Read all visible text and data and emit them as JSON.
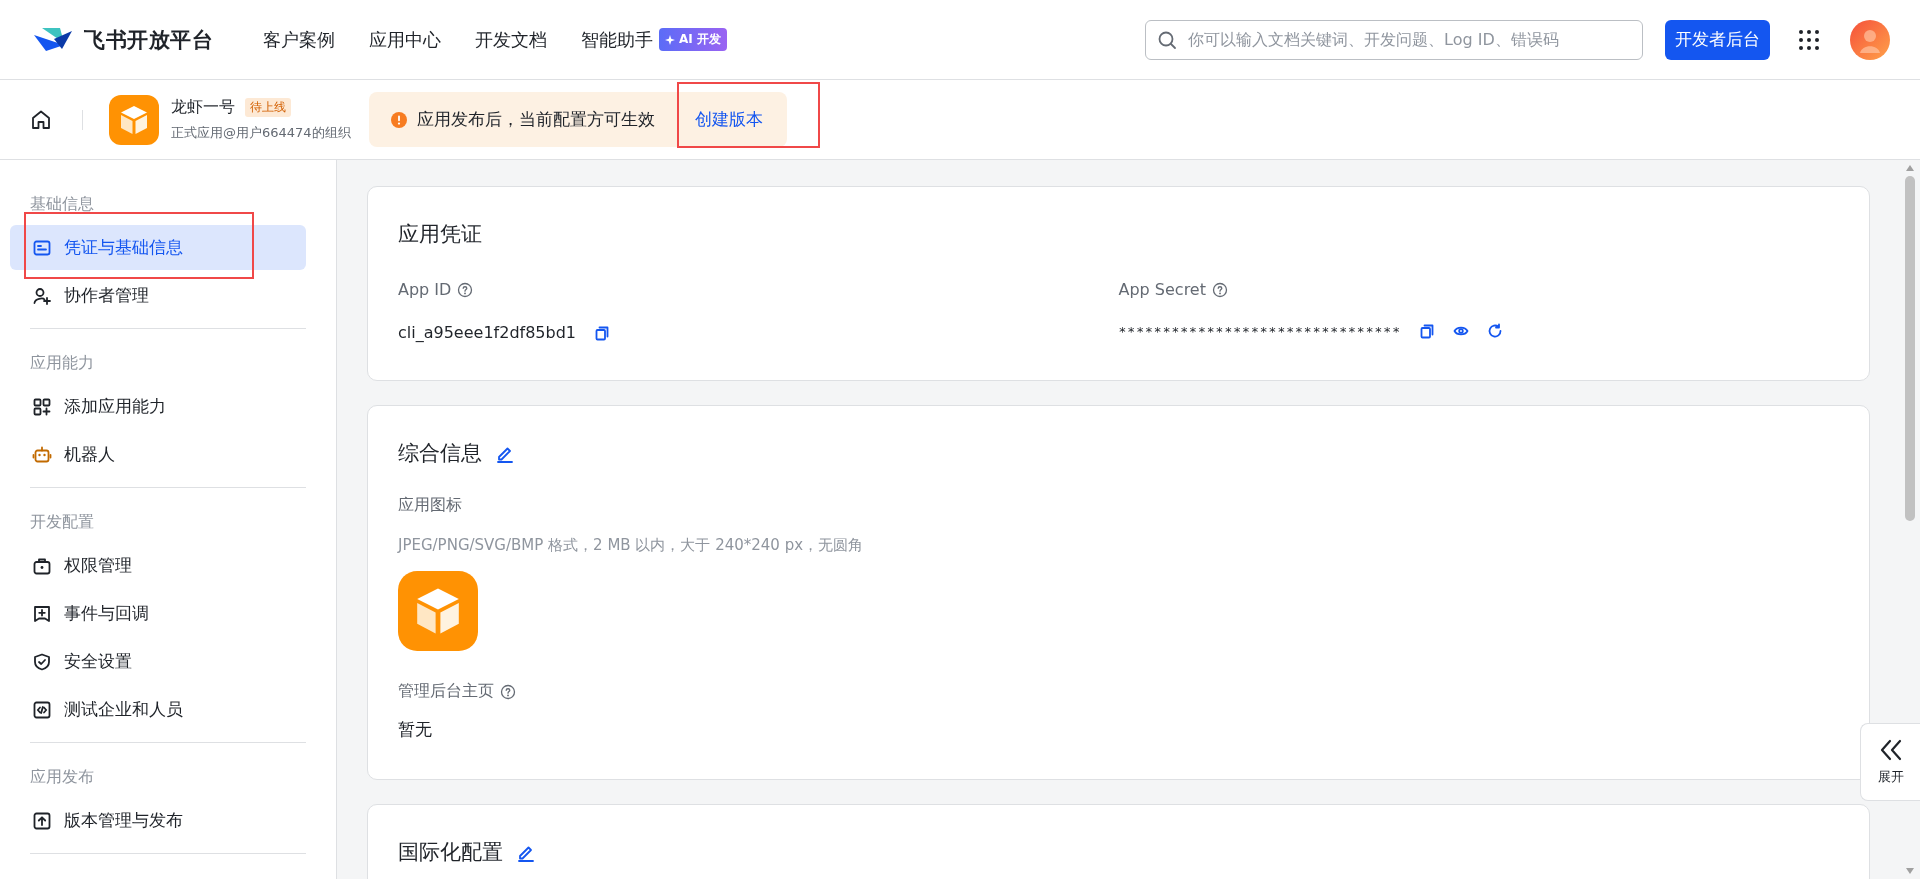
{
  "nav": {
    "logo": "飞书开放平台",
    "links": [
      {
        "label": "客户案例"
      },
      {
        "label": "应用中心"
      },
      {
        "label": "开发文档"
      },
      {
        "label": "智能助手",
        "badge": "AI 开发"
      }
    ],
    "search": {
      "placeholder": "你可以输入文档关键词、开发问题、Log ID、错误码"
    },
    "console_button": "开发者后台"
  },
  "app_header": {
    "name": "龙虾一号",
    "status": "待上线",
    "subtitle": "正式应用@用户664474的组织"
  },
  "notice": {
    "message": "应用发布后，当前配置方可生效",
    "action": {
      "label": "创建版本",
      "highlighted": true
    }
  },
  "sidebar": {
    "sections": [
      {
        "title": "基础信息",
        "items": [
          {
            "label": "凭证与基础信息",
            "selected": true,
            "highlighted": true
          },
          {
            "label": "协作者管理",
            "selected": false,
            "highlighted": false
          }
        ]
      },
      {
        "title": "应用能力",
        "items": [
          {
            "label": "添加应用能力",
            "selected": false,
            "highlighted": false
          },
          {
            "label": "机器人",
            "selected": false,
            "highlighted": false
          }
        ]
      },
      {
        "title": "开发配置",
        "items": [
          {
            "label": "权限管理",
            "selected": false,
            "highlighted": false
          },
          {
            "label": "事件与回调",
            "selected": false,
            "highlighted": false
          },
          {
            "label": "安全设置",
            "selected": false,
            "highlighted": false
          },
          {
            "label": "测试企业和人员",
            "selected": false,
            "highlighted": false
          }
        ]
      },
      {
        "title": "应用发布",
        "items": [
          {
            "label": "版本管理与发布",
            "selected": false,
            "highlighted": false
          }
        ]
      }
    ]
  },
  "cards": [
    {
      "kind": "credentials",
      "title": "应用凭证",
      "fields": [
        {
          "kind": "id",
          "label": "App ID",
          "value": "cli_a95eee1f2df85bd1"
        },
        {
          "kind": "secret",
          "label": "App Secret",
          "value": "********************************"
        }
      ]
    },
    {
      "kind": "info",
      "title": "综合信息",
      "items": [
        {
          "kind": "image",
          "label": "应用图标",
          "hint": "JPEG/PNG/SVG/BMP 格式，2 MB 以内，大于 240*240 px，无圆角"
        },
        {
          "kind": "text",
          "label": "管理后台主页",
          "value": "暂无"
        }
      ]
    },
    {
      "kind": "info",
      "title": "国际化配置"
    }
  ],
  "side_toggle": {
    "label": "展开"
  }
}
